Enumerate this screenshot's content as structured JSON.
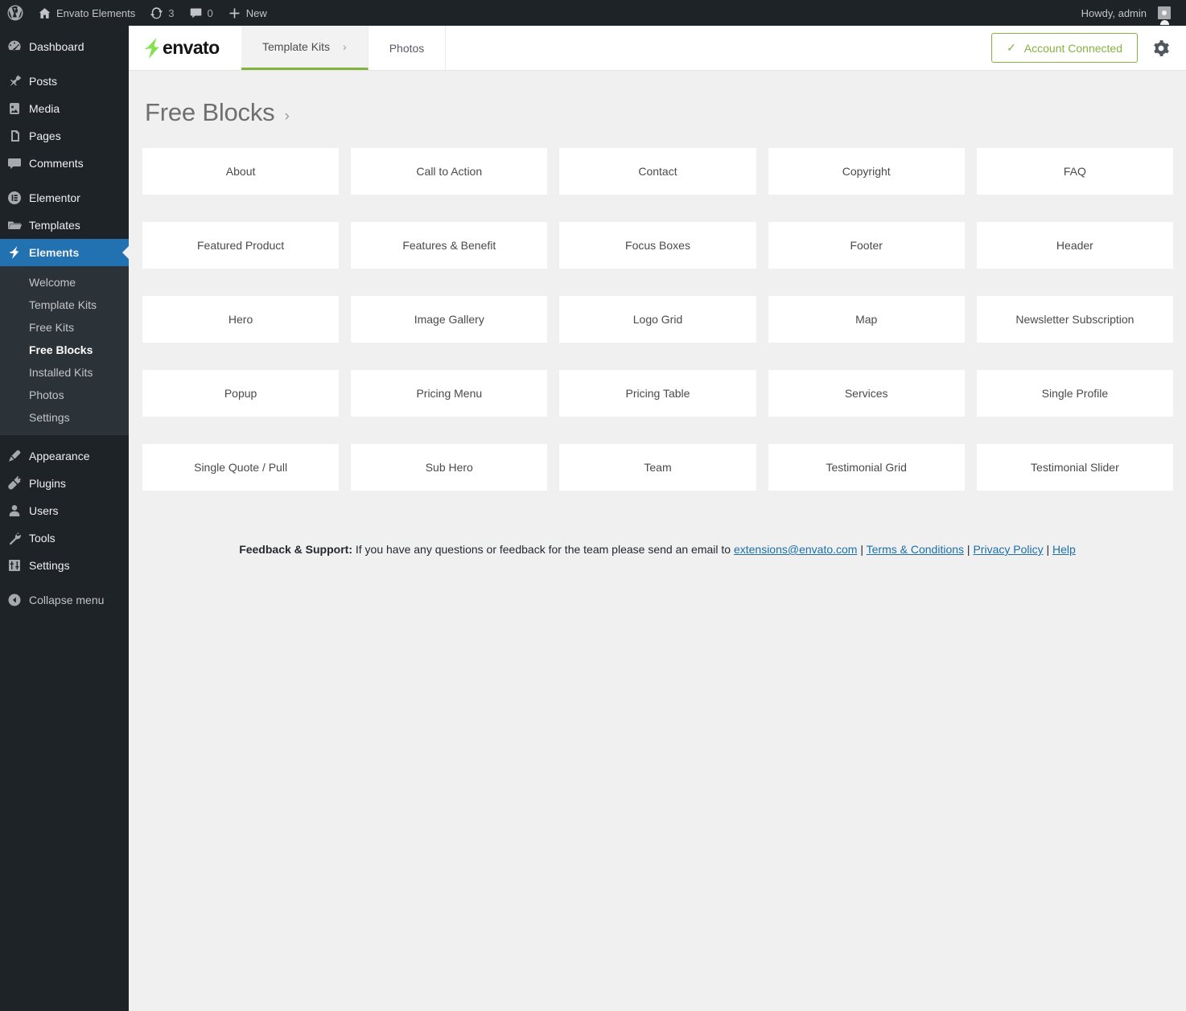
{
  "adminbar": {
    "wp_logo": "wordpress-icon",
    "site_name": "Envato Elements",
    "updates_count": "3",
    "comments_count": "0",
    "new_label": "New",
    "howdy": "Howdy, admin"
  },
  "sidebar": {
    "items": [
      {
        "label": "Dashboard",
        "icon": "dashboard-icon",
        "name": "dashboard"
      },
      {
        "label": "Posts",
        "icon": "pin-icon",
        "name": "posts"
      },
      {
        "label": "Media",
        "icon": "media-icon",
        "name": "media"
      },
      {
        "label": "Pages",
        "icon": "pages-icon",
        "name": "pages"
      },
      {
        "label": "Comments",
        "icon": "comment-icon",
        "name": "comments"
      },
      {
        "label": "Elementor",
        "icon": "elementor-icon",
        "name": "elementor"
      },
      {
        "label": "Templates",
        "icon": "folder-icon",
        "name": "templates"
      },
      {
        "label": "Elements",
        "icon": "envato-bolt-icon",
        "name": "elements"
      },
      {
        "label": "Appearance",
        "icon": "brush-icon",
        "name": "appearance"
      },
      {
        "label": "Plugins",
        "icon": "plug-icon",
        "name": "plugins"
      },
      {
        "label": "Users",
        "icon": "user-icon",
        "name": "users"
      },
      {
        "label": "Tools",
        "icon": "wrench-icon",
        "name": "tools"
      },
      {
        "label": "Settings",
        "icon": "settings-icon",
        "name": "settings"
      }
    ],
    "submenu": [
      {
        "label": "Welcome",
        "name": "welcome"
      },
      {
        "label": "Template Kits",
        "name": "template-kits"
      },
      {
        "label": "Free Kits",
        "name": "free-kits"
      },
      {
        "label": "Free Blocks",
        "name": "free-blocks"
      },
      {
        "label": "Installed Kits",
        "name": "installed-kits"
      },
      {
        "label": "Photos",
        "name": "photos"
      },
      {
        "label": "Settings",
        "name": "settings"
      }
    ],
    "collapse_label": "Collapse menu",
    "active_item": "Elements",
    "active_submenu": "Free Blocks",
    "colors": {
      "bg": "#1d2327",
      "submenu_bg": "#2c3338",
      "active": "#2271b1"
    }
  },
  "header": {
    "logo_text": "envato",
    "logo_bolt_color": "#82e14c",
    "tabs": [
      {
        "label": "Template Kits",
        "active": true,
        "chevron": "›"
      },
      {
        "label": "Photos",
        "active": false,
        "chevron": ""
      }
    ],
    "account_button": {
      "label": "Account Connected",
      "check": "✓",
      "color": "#82b440"
    },
    "gear_icon": "gear-icon"
  },
  "page": {
    "title": "Free Blocks",
    "title_chevron": "›"
  },
  "blocks": [
    "About",
    "Call to Action",
    "Contact",
    "Copyright",
    "FAQ",
    "Featured Product",
    "Features & Benefit",
    "Focus Boxes",
    "Footer",
    "Header",
    "Hero",
    "Image Gallery",
    "Logo Grid",
    "Map",
    "Newsletter Subscription",
    "Popup",
    "Pricing Menu",
    "Pricing Table",
    "Services",
    "Single Profile",
    "Single Quote / Pull",
    "Sub Hero",
    "Team",
    "Testimonial Grid",
    "Testimonial Slider"
  ],
  "feedback": {
    "label": "Feedback & Support:",
    "text": " If you have any questions or feedback for the team please send an email to ",
    "email": "extensions@envato.com",
    "sep1": " | ",
    "terms": "Terms & Conditions",
    "sep2": " | ",
    "privacy": "Privacy Policy",
    "sep3": " | ",
    "help": "Help"
  }
}
